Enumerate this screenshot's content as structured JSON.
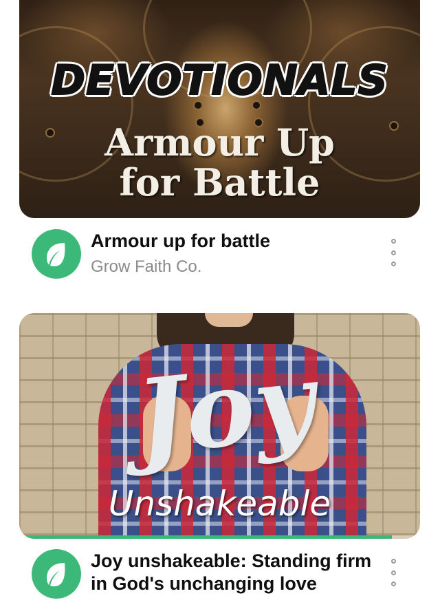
{
  "feed": {
    "items": [
      {
        "thumbnail": {
          "headline": "DEVOTIONALS",
          "subtitle_line1": "Armour Up",
          "subtitle_line2": "for Battle"
        },
        "title": "Armour up for battle",
        "channel": "Grow Faith Co.",
        "channel_logo_icon": "leaf-icon",
        "menu_icon": "more-vertical-icon"
      },
      {
        "thumbnail": {
          "headline": "Joy",
          "subtitle_line1": "Unshakeable",
          "watch_progress_fraction": 0.93
        },
        "title": "Joy unshakeable: Standing firm in God's unchanging love",
        "channel_logo_icon": "leaf-icon",
        "menu_icon": "more-vertical-icon"
      }
    ]
  },
  "colors": {
    "brand_green": "#3cb878",
    "title_text": "#0f0f0f",
    "secondary_text": "#8a8a8a"
  }
}
